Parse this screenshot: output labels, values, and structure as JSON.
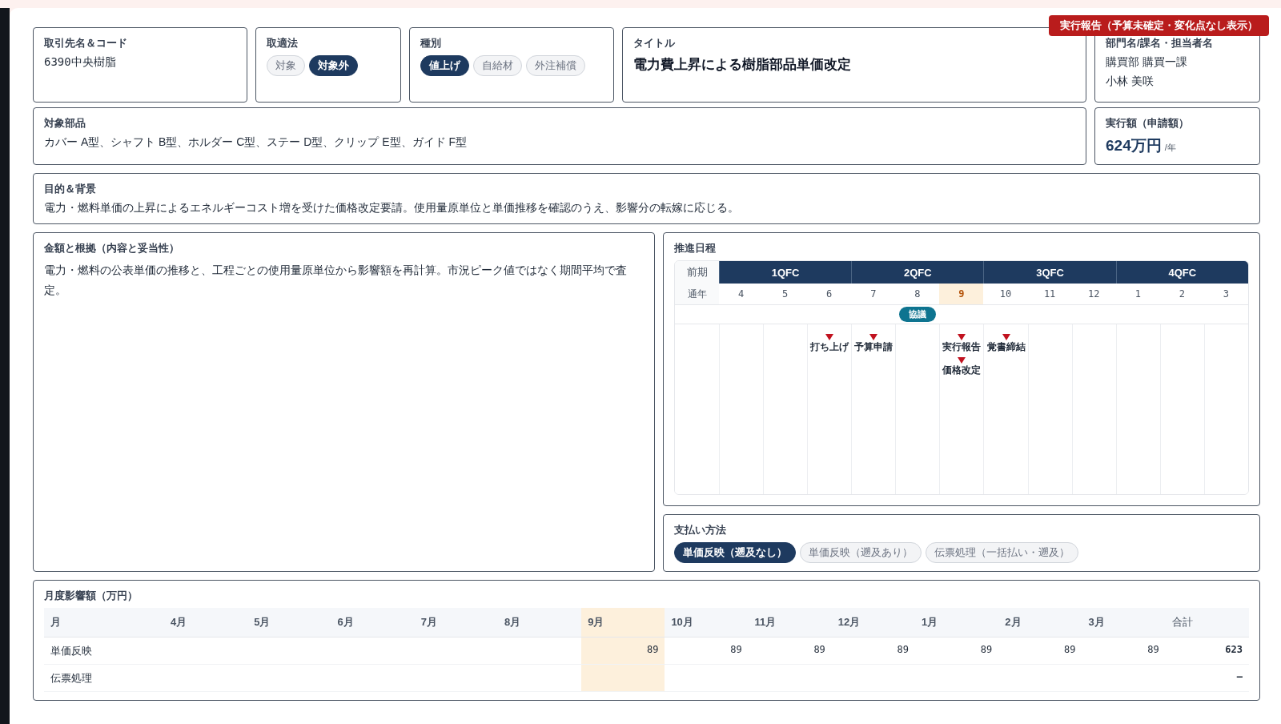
{
  "status_badge": "実行報告（予算未確定・変化点なし表示）",
  "supplier": {
    "label": "取引先名＆コード",
    "value": "6390中央樹脂"
  },
  "law": {
    "label": "取適法",
    "options": [
      {
        "label": "対象",
        "selected": false
      },
      {
        "label": "対象外",
        "selected": true
      }
    ]
  },
  "category": {
    "label": "種別",
    "options": [
      {
        "label": "値上げ",
        "selected": true
      },
      {
        "label": "自給材",
        "selected": false
      },
      {
        "label": "外注補償",
        "selected": false
      }
    ]
  },
  "title": {
    "label": "タイトル",
    "value": "電力費上昇による樹脂部品単価改定"
  },
  "department": {
    "label": "部門名/課名・担当者名",
    "lines": [
      "購買部 購買一課",
      "小林 美咲"
    ]
  },
  "parts": {
    "label": "対象部品",
    "value": "カバー A型、シャフト B型、ホルダー C型、ステー D型、クリップ E型、ガイド F型"
  },
  "amount": {
    "label": "実行額（申請額）",
    "value": "624万円",
    "unit": "/年"
  },
  "purpose": {
    "label": "目的＆背景",
    "value": "電力・燃料単価の上昇によるエネルギーコスト増を受けた価格改定要請。使用量原単位と単価推移を確認のうえ、影響分の転嫁に応じる。"
  },
  "basis": {
    "label": "金額と根拠（内容と妥当性）",
    "value": "電力・燃料の公表単価の推移と、工程ごとの使用量原単位から影響額を再計算。市況ピーク値ではなく期間平均で査定。"
  },
  "schedule": {
    "label": "推進日程",
    "half_label": "前期",
    "year_label": "通年",
    "quarters": [
      "1QFC",
      "2QFC",
      "3QFC",
      "4QFC"
    ],
    "months": [
      {
        "label": "4",
        "selected": false
      },
      {
        "label": "5",
        "selected": false
      },
      {
        "label": "6",
        "selected": false,
        "markers": [
          "打ち上げ"
        ]
      },
      {
        "label": "7",
        "selected": false,
        "markers": [
          "予算申請"
        ]
      },
      {
        "label": "8",
        "selected": false,
        "band": "協議"
      },
      {
        "label": "9",
        "selected": true,
        "markers": [
          "実行報告",
          "価格改定"
        ]
      },
      {
        "label": "10",
        "selected": false,
        "markers": [
          "覚書締結"
        ]
      },
      {
        "label": "11",
        "selected": false
      },
      {
        "label": "12",
        "selected": false
      },
      {
        "label": "1",
        "selected": false
      },
      {
        "label": "2",
        "selected": false
      },
      {
        "label": "3",
        "selected": false
      }
    ]
  },
  "payment": {
    "label": "支払い方法",
    "options": [
      {
        "label": "単価反映（遡及なし）",
        "selected": true
      },
      {
        "label": "単価反映（遡及あり）",
        "selected": false
      },
      {
        "label": "伝票処理（一括払い・遡及）",
        "selected": false
      }
    ]
  },
  "monthly": {
    "label": "月度影響額（万円）",
    "row_header": "月",
    "total_header": "合計",
    "months": [
      {
        "label": "4月",
        "selected": false
      },
      {
        "label": "5月",
        "selected": false
      },
      {
        "label": "6月",
        "selected": false
      },
      {
        "label": "7月",
        "selected": false
      },
      {
        "label": "8月",
        "selected": false
      },
      {
        "label": "9月",
        "selected": true,
        "price_reflection": "89"
      },
      {
        "label": "10月",
        "selected": false,
        "price_reflection": "89"
      },
      {
        "label": "11月",
        "selected": false,
        "price_reflection": "89"
      },
      {
        "label": "12月",
        "selected": false,
        "price_reflection": "89"
      },
      {
        "label": "1月",
        "selected": false,
        "price_reflection": "89"
      },
      {
        "label": "2月",
        "selected": false,
        "price_reflection": "89"
      },
      {
        "label": "3月",
        "selected": false,
        "price_reflection": "89"
      }
    ],
    "rows": [
      {
        "kind": "price_reflection",
        "label": "単価反映",
        "total": "623"
      },
      {
        "kind": "slip",
        "label": "伝票処理",
        "total": "–"
      }
    ]
  }
}
